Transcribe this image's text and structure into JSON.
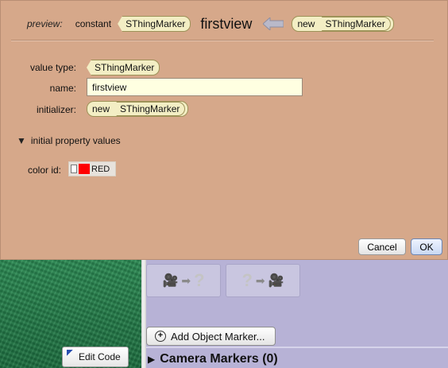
{
  "dialog": {
    "preview": {
      "label": "preview:",
      "modifier": "constant",
      "value_type": "SThingMarker",
      "name": "firstview",
      "new_keyword": "new",
      "initializer_type": "SThingMarker"
    },
    "fields": {
      "value_type_label": "value type:",
      "value_type": "SThingMarker",
      "name_label": "name:",
      "name_value": "firstview",
      "initializer_label": "initializer:",
      "initializer_new": "new",
      "initializer_type": "SThingMarker"
    },
    "property_section": {
      "label": "initial property values",
      "expanded": true,
      "color_id_label": "color id:",
      "color_id_value": "RED",
      "color_id_swatch": "#ff0000"
    },
    "buttons": {
      "cancel": "Cancel",
      "ok": "OK"
    }
  },
  "background": {
    "add_object_marker": "Add Object Marker...",
    "camera_markers": "Camera Markers (0)",
    "edit_code": "Edit Code",
    "camera_transitions": [
      {
        "from": "camera-icon",
        "to": "unknown"
      },
      {
        "from": "unknown",
        "to": "camera-icon"
      }
    ]
  },
  "colors": {
    "dialog_bg": "#d6a88a",
    "pill_bg": "#f3eec4",
    "input_bg": "#ffffe1",
    "panel_bg": "#b7b2d6"
  }
}
